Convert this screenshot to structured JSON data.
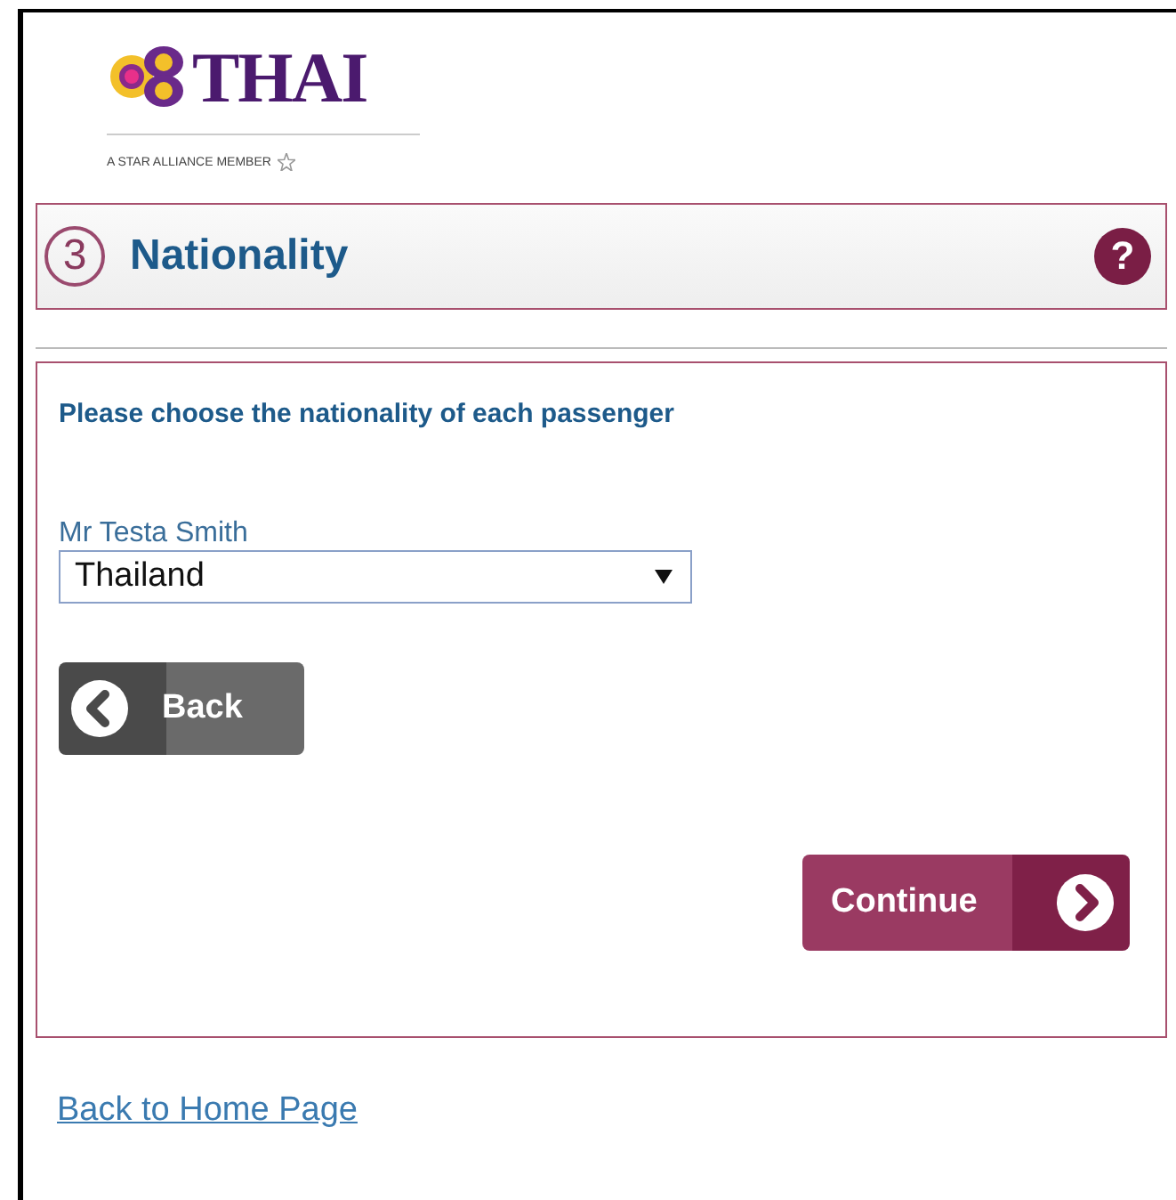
{
  "brand": {
    "name": "THAI",
    "tagline": "A STAR ALLIANCE MEMBER"
  },
  "step": {
    "number": "3",
    "title": "Nationality",
    "help": "?"
  },
  "form": {
    "instruction": "Please choose the nationality of each passenger",
    "passengers": [
      {
        "name": "Mr Testa Smith",
        "value": "Thailand"
      }
    ],
    "buttons": [
      {
        "kind": "back",
        "label": "Back"
      },
      {
        "kind": "continue",
        "label": "Continue"
      }
    ]
  },
  "footer_link": "Back to Home Page"
}
